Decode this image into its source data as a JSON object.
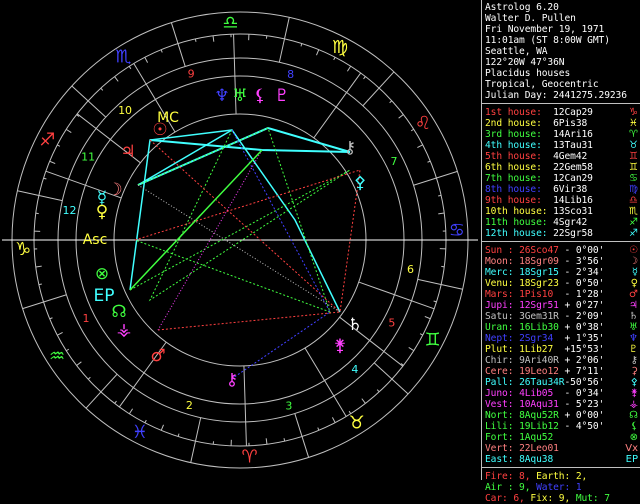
{
  "header": {
    "lines": [
      "Astrolog 6.20",
      "Walter D. Pullen",
      "Fri November 19, 1971",
      "11:01am (ST 8:00W GMT)",
      "Seattle, WA",
      "122°20W 47°36N",
      "Placidus houses",
      "Tropical, Geocentric",
      "Julian Day: 2441275.29236"
    ]
  },
  "houses": [
    {
      "label": "1st house:",
      "value": "12Cap29",
      "color": "#ff4040",
      "glyph": "♑"
    },
    {
      "label": "2nd house:",
      "value": "6Pis38",
      "color": "#ffff40",
      "glyph": "♓"
    },
    {
      "label": "3rd house:",
      "value": "14Ari16",
      "color": "#40ff40",
      "glyph": "♈"
    },
    {
      "label": "4th house:",
      "value": "13Tau31",
      "color": "#40ffff",
      "glyph": "♉"
    },
    {
      "label": "5th house:",
      "value": "4Gem42",
      "color": "#ff4040",
      "glyph": "♊"
    },
    {
      "label": "6th house:",
      "value": "22Gem58",
      "color": "#ffff40",
      "glyph": "♊"
    },
    {
      "label": "7th house:",
      "value": "12Can29",
      "color": "#40ff40",
      "glyph": "♋"
    },
    {
      "label": "8th house:",
      "value": "6Vir38",
      "color": "#4040ff",
      "glyph": "♍"
    },
    {
      "label": "9th house:",
      "value": "14Lib16",
      "color": "#ff4040",
      "glyph": "♎"
    },
    {
      "label": "10th house:",
      "value": "13Sco31",
      "color": "#ffff40",
      "glyph": "♏"
    },
    {
      "label": "11th house:",
      "value": "4Sgr42",
      "color": "#40ff40",
      "glyph": "♐"
    },
    {
      "label": "12th house:",
      "value": "22Sgr58",
      "color": "#40ffff",
      "glyph": "♐"
    }
  ],
  "planets": [
    {
      "label": "Sun :",
      "pos": "26Sco47",
      "lat": "- 0°00'",
      "color": "#ff4040",
      "glyph": "☉"
    },
    {
      "label": "Moon:",
      "pos": "18Sgr09",
      "lat": "- 3°56'",
      "color": "#ff8080",
      "glyph": "☽"
    },
    {
      "label": "Merc:",
      "pos": "18Sgr15",
      "lat": "- 2°34'",
      "color": "#40ffff",
      "glyph": "☿"
    },
    {
      "label": "Venu:",
      "pos": "18Sgr23",
      "lat": "- 0°50'",
      "color": "#ffff40",
      "glyph": "♀"
    },
    {
      "label": "Mars:",
      "pos": "1Pis10",
      "lat": "- 1°28'",
      "color": "#ff4040",
      "glyph": "♂"
    },
    {
      "label": "Jupi:",
      "pos": "12Sgr51",
      "lat": "+ 0°27'",
      "color": "#ff40ff",
      "glyph": "♃"
    },
    {
      "label": "Satu:",
      "pos": "3Gem31R",
      "lat": "- 2°09'",
      "color": "#c0c0c0",
      "glyph": "♄"
    },
    {
      "label": "Uran:",
      "pos": "16Lib30",
      "lat": "+ 0°38'",
      "color": "#40ff40",
      "glyph": "♅"
    },
    {
      "label": "Nept:",
      "pos": "2Sgr34",
      "lat": "+ 1°35'",
      "color": "#4040ff",
      "glyph": "♆"
    },
    {
      "label": "Plut:",
      "pos": "1Lib27",
      "lat": "+15°53'",
      "color": "#ffff40",
      "glyph": "♇"
    },
    {
      "label": "Chir:",
      "pos": "9Ari40R",
      "lat": "+ 2°06'",
      "color": "#c0c0c0",
      "glyph": "⚷"
    },
    {
      "label": "Cere:",
      "pos": "19Leo12",
      "lat": "+ 7°11'",
      "color": "#ff8080",
      "glyph": "⚳"
    },
    {
      "label": "Pall:",
      "pos": "26Tau34R",
      "lat": "-50°56'",
      "color": "#40ffff",
      "glyph": "⚴"
    },
    {
      "label": "Juno:",
      "pos": "4Lib05",
      "lat": "- 0°34'",
      "color": "#ff40ff",
      "glyph": "⚵"
    },
    {
      "label": "Vest:",
      "pos": "10Aqu31",
      "lat": "- 5°23'",
      "color": "#ff40ff",
      "glyph": "⚶"
    },
    {
      "label": "Nort:",
      "pos": "8Aqu52R",
      "lat": "+ 0°00'",
      "color": "#40ff40",
      "glyph": "☊"
    },
    {
      "label": "Lili:",
      "pos": "19Lib12",
      "lat": "- 4°50'",
      "color": "#40ff40",
      "glyph": "⚸"
    },
    {
      "label": "Fort:",
      "pos": "1Aqu52",
      "lat": "",
      "color": "#40ff40",
      "glyph": "⊗"
    },
    {
      "label": "Vert:",
      "pos": "22Leo01",
      "lat": "",
      "color": "#ff8080",
      "glyph": "Vx"
    },
    {
      "label": "East:",
      "pos": "8Aqu38",
      "lat": "",
      "color": "#40ffff",
      "glyph": "EP"
    }
  ],
  "elements": {
    "line1": [
      {
        "t": "Fire: 8,",
        "c": "#ff4040"
      },
      {
        "t": " Earth: 2,",
        "c": "#ffff40"
      }
    ],
    "line2": [
      {
        "t": "Air : 9,",
        "c": "#40ff40"
      },
      {
        "t": " Water: 1",
        "c": "#4040ff"
      }
    ],
    "line3": [
      {
        "t": "Car: 6,",
        "c": "#ff4040"
      },
      {
        "t": " Fix: 9,",
        "c": "#ffff40"
      },
      {
        "t": " Mut: 7",
        "c": "#40ff40"
      }
    ]
  },
  "wheel": {
    "signs": [
      {
        "g": "♑",
        "c": "#ffff40"
      },
      {
        "g": "♒",
        "c": "#40ff40"
      },
      {
        "g": "♓",
        "c": "#4040ff"
      },
      {
        "g": "♈",
        "c": "#ff4040"
      },
      {
        "g": "♉",
        "c": "#ffff40"
      },
      {
        "g": "♊",
        "c": "#40ff40"
      },
      {
        "g": "♋",
        "c": "#4040ff"
      },
      {
        "g": "♌",
        "c": "#ff4040"
      },
      {
        "g": "♍",
        "c": "#ffff40"
      },
      {
        "g": "♎",
        "c": "#40ff40"
      },
      {
        "g": "♏",
        "c": "#4040ff"
      },
      {
        "g": "♐",
        "c": "#ff4040"
      }
    ],
    "house_numbers": [
      {
        "n": "1",
        "c": "#ff4040"
      },
      {
        "n": "2",
        "c": "#ffff40"
      },
      {
        "n": "3",
        "c": "#40ff40"
      },
      {
        "n": "4",
        "c": "#40ffff"
      },
      {
        "n": "5",
        "c": "#ff4040"
      },
      {
        "n": "6",
        "c": "#ffff40"
      },
      {
        "n": "7",
        "c": "#40ff40"
      },
      {
        "n": "8",
        "c": "#4040ff"
      },
      {
        "n": "9",
        "c": "#ff4040"
      },
      {
        "n": "10",
        "c": "#ffff40"
      },
      {
        "n": "11",
        "c": "#40ff40"
      },
      {
        "n": "12",
        "c": "#40ffff"
      }
    ],
    "angles": {
      "asc": "Asc",
      "mc": "MC"
    }
  }
}
